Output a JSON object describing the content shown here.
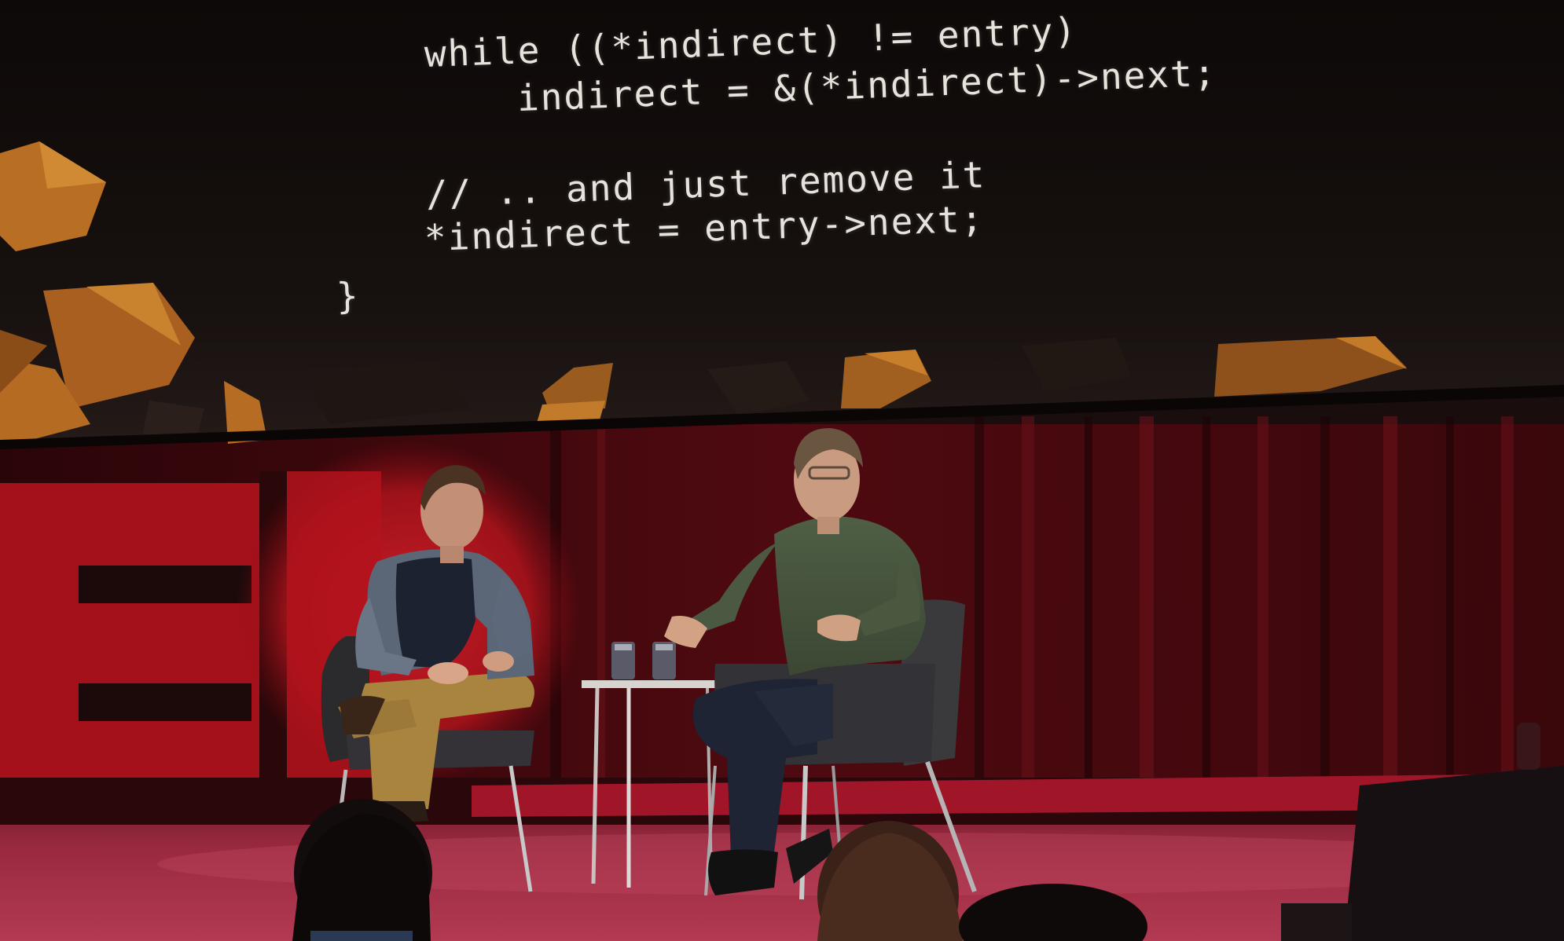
{
  "slide": {
    "code_lines": [
      "while ((*indirect) != entry)",
      "indirect = &(*indirect)->next;",
      "// .. and just remove it",
      "*indirect = entry->next;",
      "}"
    ]
  },
  "colors": {
    "screen_bg": "#120c0b",
    "polygon_accent": "#c07826",
    "curtain": "#5a0d14",
    "ted_red": "#b0141c",
    "stage_floor": "#9c2a3e"
  }
}
